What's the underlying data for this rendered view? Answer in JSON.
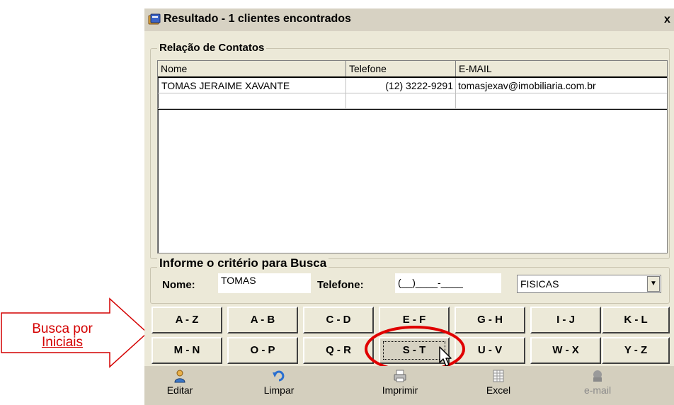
{
  "window": {
    "title": "Resultado - 1 clientes encontrados",
    "close_glyph": "x"
  },
  "contacts": {
    "legend": "Relação de Contatos",
    "columns": [
      "Nome",
      "Telefone",
      "E-MAIL"
    ],
    "rows": [
      {
        "nome": "TOMAS JERAIME XAVANTE",
        "telefone": "(12) 3222-9291",
        "email": "tomasjexav@imobiliaria.com.br"
      }
    ]
  },
  "search": {
    "legend": "Informe o critério para Busca",
    "nome_label": "Nome:",
    "nome_value": "TOMAS",
    "telefone_label": "Telefone:",
    "telefone_mask": "(__)____-____",
    "tipo_value": "FISICAS"
  },
  "alpha_buttons": {
    "row1": [
      "A - Z",
      "A - B",
      "C - D",
      "E - F",
      "G - H",
      "I - J",
      "K - L"
    ],
    "row2": [
      "M - N",
      "O - P",
      "Q - R",
      "S - T",
      "U - V",
      "W - X",
      "Y - Z"
    ],
    "selected": "S - T"
  },
  "toolbar": {
    "items": [
      {
        "label": "Editar",
        "icon": "user-edit-icon",
        "enabled": true
      },
      {
        "label": "Limpar",
        "icon": "undo-icon",
        "enabled": true
      },
      {
        "label": "Imprimir",
        "icon": "printer-icon",
        "enabled": true
      },
      {
        "label": "Excel",
        "icon": "spreadsheet-icon",
        "enabled": true
      },
      {
        "label": "e-mail",
        "icon": "email-icon",
        "enabled": false
      }
    ]
  },
  "annotation": {
    "callout_line1": "Busca por",
    "callout_line2": "Iniciais",
    "color": "#d40000"
  }
}
